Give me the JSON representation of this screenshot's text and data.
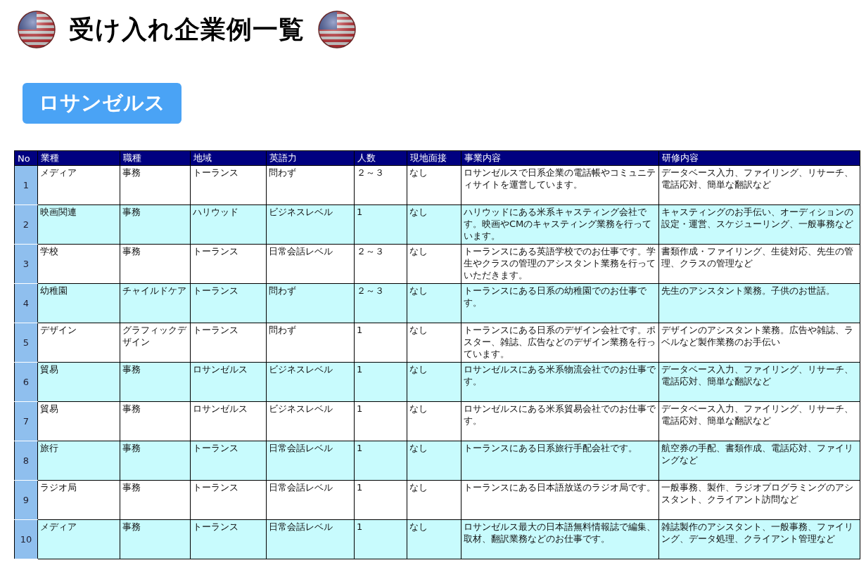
{
  "title": "受け入れ企業例一覧",
  "section": "ロサンゼルス",
  "table": {
    "columns": [
      "No",
      "業種",
      "職種",
      "地域",
      "英語力",
      "人数",
      "現地面接",
      "事業内容",
      "研修内容"
    ],
    "rows": [
      [
        "1",
        "メディア",
        "事務",
        "トーランス",
        "問わず",
        "２～３",
        "なし",
        "ロサンゼルスで日系企業の電話帳やコミュニティサイトを運営しています。",
        "データベース入力、ファイリング、リサーチ、電話応対、簡単な翻訳など"
      ],
      [
        "2",
        "映画関連",
        "事務",
        "ハリウッド",
        "ビジネスレベル",
        "1",
        "なし",
        "ハリウッドにある米系キャスティング会社です。映画やCMのキャスティング業務を行っています。",
        "キャスティングのお手伝い、オーディションの設定・運営、スケジューリング、一般事務など"
      ],
      [
        "3",
        "学校",
        "事務",
        "トーランス",
        "日常会話レベル",
        "２～３",
        "なし",
        "トーランスにある英語学校でのお仕事です。学生やクラスの管理のアシスタント業務を行っていただきます。",
        "書類作成・ファイリング、生徒対応、先生の管理、クラスの管理など"
      ],
      [
        "4",
        "幼稚園",
        "チャイルドケア",
        "トーランス",
        "問わず",
        "２～３",
        "なし",
        "トーランスにある日系の幼稚園でのお仕事です。",
        "先生のアシスタント業務。子供のお世話。"
      ],
      [
        "5",
        "デザイン",
        "グラフィックデザイン",
        "トーランス",
        "問わず",
        "1",
        "なし",
        "トーランスにある日系のデザイン会社です。ポスター、雑誌、広告などのデザイン業務を行っています。",
        "デザインのアシスタント業務。広告や雑誌、ラベルなど製作業務のお手伝い"
      ],
      [
        "6",
        "貿易",
        "事務",
        "ロサンゼルス",
        "ビジネスレベル",
        "1",
        "なし",
        "ロサンゼルスにある米系物流会社でのお仕事です。",
        "データベース入力、ファイリング、リサーチ、電話応対、簡単な翻訳など"
      ],
      [
        "7",
        "貿易",
        "事務",
        "ロサンゼルス",
        "ビジネスレベル",
        "1",
        "なし",
        "ロサンゼルスにある米系貿易会社でのお仕事です。",
        "データベース入力、ファイリング、リサーチ、電話応対、簡単な翻訳など"
      ],
      [
        "8",
        "旅行",
        "事務",
        "トーランス",
        "日常会話レベル",
        "1",
        "なし",
        "トーランスにある日系旅行手配会社です。",
        "航空券の手配、書類作成、電話応対、ファイリングなど"
      ],
      [
        "9",
        "ラジオ局",
        "事務",
        "トーランス",
        "日常会話レベル",
        "1",
        "なし",
        "トーランスにある日本語放送のラジオ局です。",
        "一般事務、製作、ラジオプログラミングのアシスタント、クライアント訪問など"
      ],
      [
        "10",
        "メディア",
        "事務",
        "トーランス",
        "日常会話レベル",
        "1",
        "なし",
        "ロサンゼルス最大の日本語無料情報誌で編集、取材、翻訳業務などのお仕事です。",
        "雑誌製作のアシスタント、一般事務、ファイリング、データ処理、クライアント管理など"
      ]
    ]
  }
}
